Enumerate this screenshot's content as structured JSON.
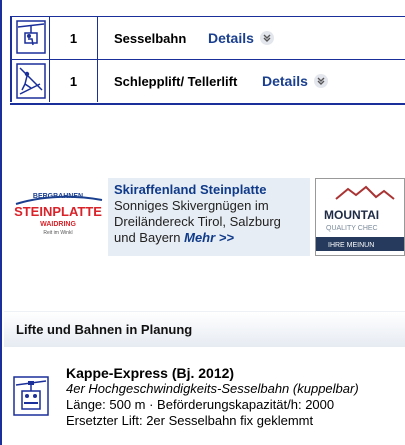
{
  "lifts": [
    {
      "icon": "chairlift-icon",
      "count": "1",
      "name": "Sesselbahn",
      "details_label": "Details"
    },
    {
      "icon": "tow-lift-icon",
      "count": "1",
      "name": "Schlepplift/ Tellerlift",
      "details_label": "Details"
    }
  ],
  "banner": {
    "steinplatte_logo": {
      "top": "BERGBAHNEN",
      "main": "STEINPLATTE",
      "sub": "WAIDRING",
      "tag": "Reit im Winkl"
    },
    "promo": {
      "title": "Skiraffenland Steinplatte",
      "text": "Sonniges Skivergnügen im Dreiländereck Tirol, Salzburg und Bayern",
      "more": "Mehr >>"
    },
    "mqc_logo": {
      "line1": "MOUNTAI",
      "line2": "QUALITY CHEC",
      "line3": "IHRE MEINUN"
    }
  },
  "planning": {
    "heading": "Lifte und Bahnen in Planung",
    "items": [
      {
        "icon": "chairlift-planned-icon",
        "title": "Kappe-Express (Bj. 2012)",
        "type": "4er Hochgeschwindigkeits-Sesselbahn (kuppelbar)",
        "specs": "Länge: 500 m · Beförderungskapazität/h: 2000",
        "replaces": "Ersetzter Lift: 2er Sesselbahn fix geklemmt"
      }
    ]
  },
  "colors": {
    "accent": "#1a2f9a",
    "link": "#1a3f8f",
    "promo_bg": "#e7edf4",
    "brand_red": "#d8232a"
  }
}
